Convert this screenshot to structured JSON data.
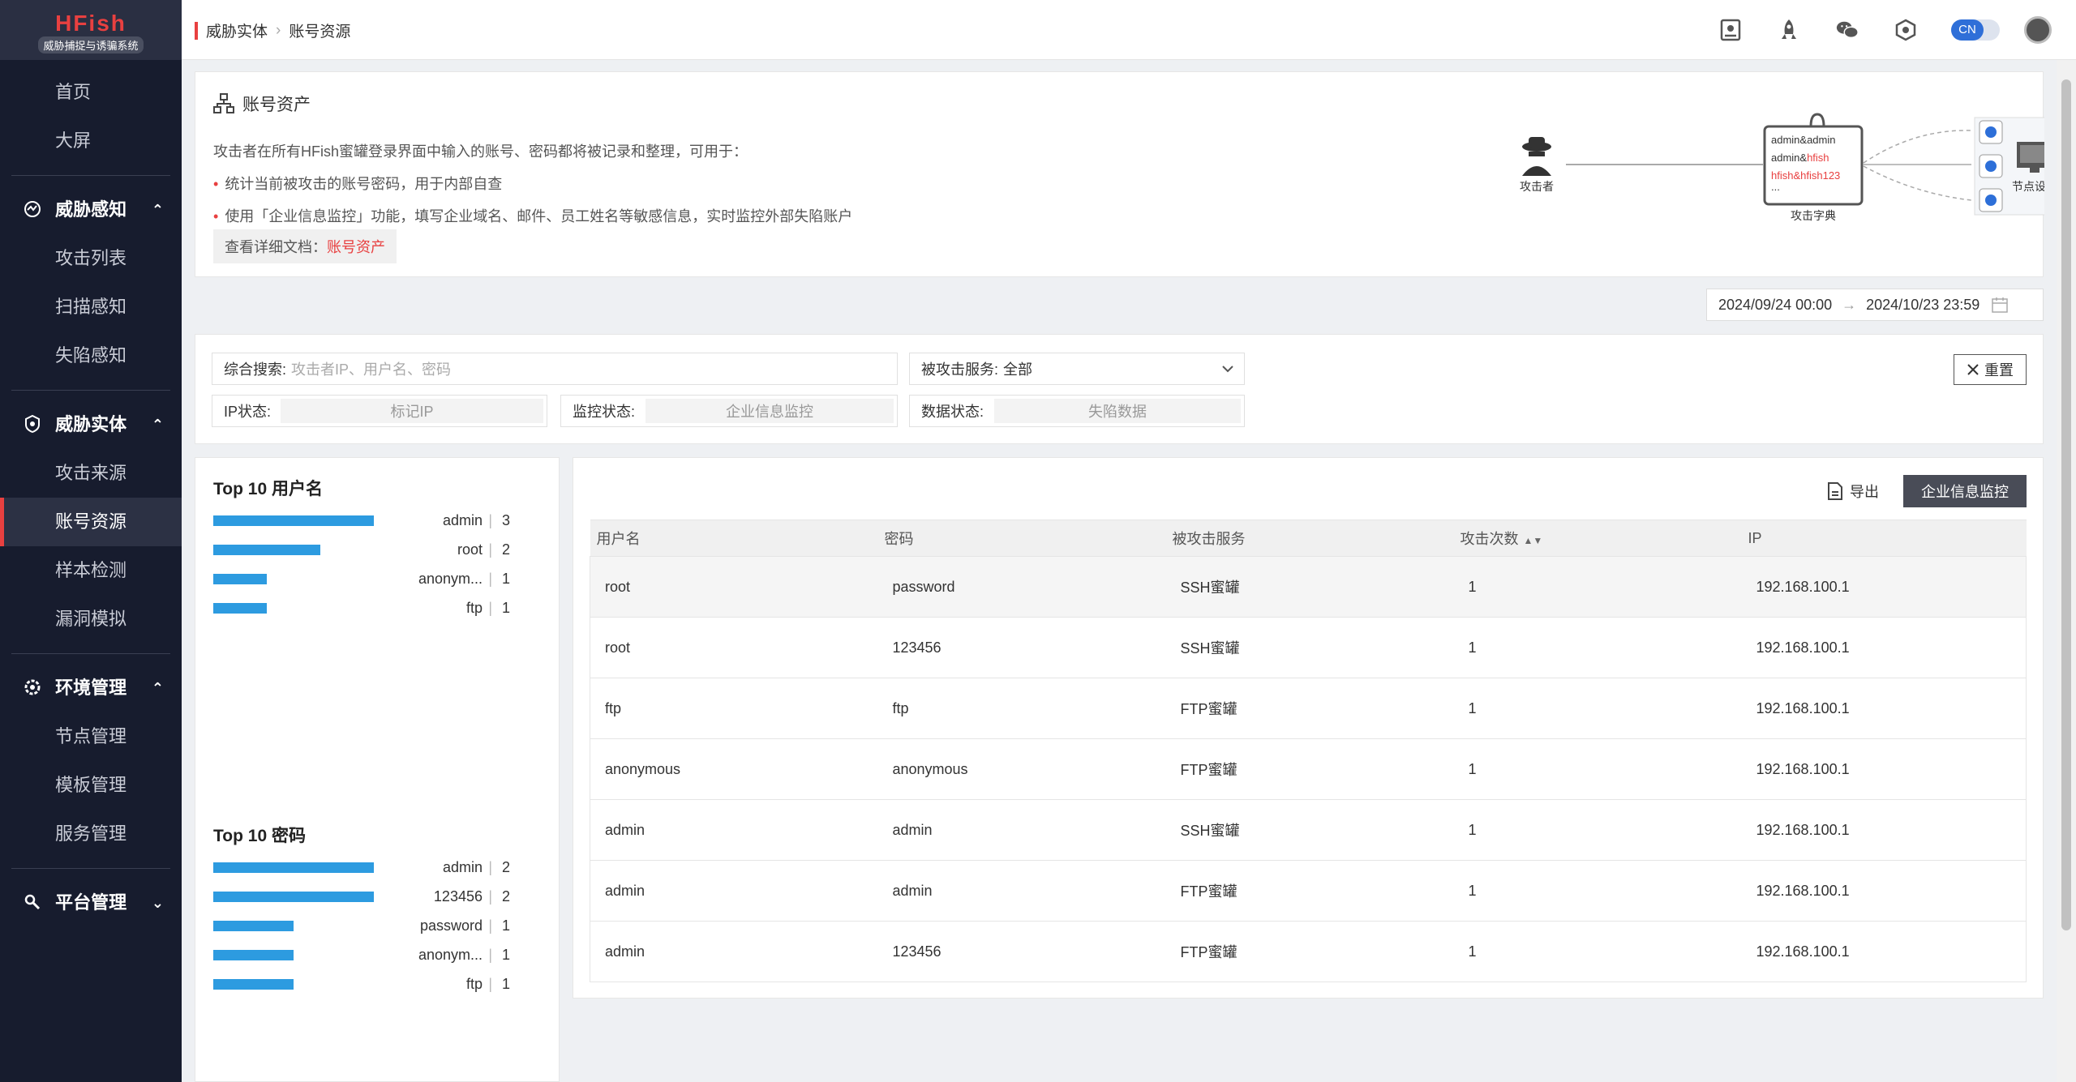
{
  "app": {
    "logo": "HFish",
    "subtitle": "威胁捕捉与诱骗系统"
  },
  "sidebar": {
    "top_items": [
      {
        "label": "首页"
      },
      {
        "label": "大屏"
      }
    ],
    "groups": [
      {
        "title": "威胁感知",
        "icon": "radar-icon",
        "expanded": true,
        "items": [
          {
            "label": "攻击列表"
          },
          {
            "label": "扫描感知"
          },
          {
            "label": "失陷感知"
          }
        ]
      },
      {
        "title": "威胁实体",
        "icon": "shield-icon",
        "expanded": true,
        "items": [
          {
            "label": "攻击来源"
          },
          {
            "label": "账号资源",
            "active": true
          },
          {
            "label": "样本检测"
          },
          {
            "label": "漏洞模拟"
          }
        ]
      },
      {
        "title": "环境管理",
        "icon": "gear-icon",
        "expanded": true,
        "items": [
          {
            "label": "节点管理"
          },
          {
            "label": "模板管理"
          },
          {
            "label": "服务管理"
          }
        ]
      },
      {
        "title": "平台管理",
        "icon": "tools-icon",
        "expanded": false,
        "items": []
      }
    ]
  },
  "header": {
    "breadcrumb": [
      "威胁实体",
      "账号资源"
    ],
    "lang": "CN",
    "icons": [
      "book-icon",
      "rocket-icon",
      "wechat-icon",
      "hexagon-icon"
    ]
  },
  "intro": {
    "title": "账号资产",
    "desc": "攻击者在所有HFish蜜罐登录界面中输入的账号、密码都将被记录和整理，可用于：",
    "bullet1": "统计当前被攻击的账号密码，用于内部自查",
    "bullet2": "使用「企业信息监控」功能，填写企业域名、邮件、员工姓名等敏感信息，实时监控外部失陷账户",
    "doc_label": "查看详细文档：",
    "doc_link": "账号资产",
    "diagram": {
      "attacker": "攻击者",
      "dict_label": "攻击字典",
      "dict_lines": [
        "admin&admin",
        "admin&",
        "hfish",
        "hfish&hfish123",
        "..."
      ],
      "node_label": "节点设备"
    }
  },
  "daterange": {
    "start": "2024/09/24 00:00",
    "end": "2024/10/23 23:59"
  },
  "filters": {
    "search_label": "综合搜索:",
    "search_placeholder": "攻击者IP、用户名、密码",
    "service_label": "被攻击服务:",
    "service_value": "全部",
    "ip_status_label": "IP状态:",
    "ip_status_value": "标记IP",
    "monitor_label": "监控状态:",
    "monitor_value": "企业信息监控",
    "data_label": "数据状态:",
    "data_value": "失陷数据",
    "reset": "重置"
  },
  "top_usernames": {
    "title": "Top 10 用户名",
    "items": [
      {
        "name": "admin",
        "count": 3
      },
      {
        "name": "root",
        "count": 2
      },
      {
        "name": "anonym...",
        "count": 1
      },
      {
        "name": "ftp",
        "count": 1
      }
    ]
  },
  "top_passwords": {
    "title": "Top 10 密码",
    "items": [
      {
        "name": "admin",
        "count": 2
      },
      {
        "name": "123456",
        "count": 2
      },
      {
        "name": "password",
        "count": 1
      },
      {
        "name": "anonym...",
        "count": 1
      },
      {
        "name": "ftp",
        "count": 1
      }
    ]
  },
  "table": {
    "export": "导出",
    "monitor_button": "企业信息监控",
    "columns": [
      "用户名",
      "密码",
      "被攻击服务",
      "攻击次数",
      "IP"
    ],
    "rows": [
      [
        "root",
        "password",
        "SSH蜜罐",
        "1",
        "192.168.100.1"
      ],
      [
        "root",
        "123456",
        "SSH蜜罐",
        "1",
        "192.168.100.1"
      ],
      [
        "ftp",
        "ftp",
        "FTP蜜罐",
        "1",
        "192.168.100.1"
      ],
      [
        "anonymous",
        "anonymous",
        "FTP蜜罐",
        "1",
        "192.168.100.1"
      ],
      [
        "admin",
        "admin",
        "SSH蜜罐",
        "1",
        "192.168.100.1"
      ],
      [
        "admin",
        "admin",
        "FTP蜜罐",
        "1",
        "192.168.100.1"
      ],
      [
        "admin",
        "123456",
        "FTP蜜罐",
        "1",
        "192.168.100.1"
      ]
    ]
  },
  "colors": {
    "accent": "#e84040",
    "bar": "#2d9be0",
    "sidebar": "#171c2e"
  }
}
